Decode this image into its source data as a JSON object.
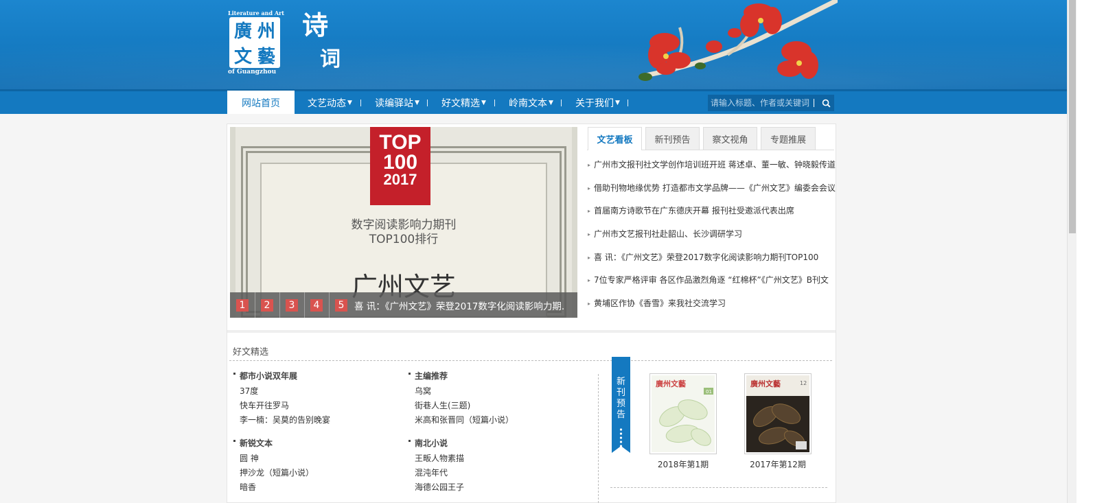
{
  "header": {
    "logo": {
      "top_text": "Literature and Art",
      "bottom_text": "of Guangzhou",
      "mark_chars": [
        "廣",
        "州",
        "文",
        "藝"
      ]
    },
    "section_title": [
      "诗",
      "词"
    ]
  },
  "nav": {
    "home": "网站首页",
    "items": [
      "文艺动态",
      "读编驿站",
      "好文精选",
      "岭南文本",
      "关于我们"
    ],
    "search_placeholder": "请输入标题、作者或关键词"
  },
  "slider": {
    "badge": [
      "TOP",
      "100",
      "2017"
    ],
    "line1": "数字阅读影响力期刊",
    "line2": "TOP100排行",
    "title": "广州文艺",
    "dots": [
      "1",
      "2",
      "3",
      "4",
      "5"
    ],
    "caption": "喜 讯：《广州文艺》荣登2017数字化阅读影响力期."
  },
  "tabs": [
    "文艺看板",
    "新刊预告",
    "察文视角",
    "专题推展"
  ],
  "news": [
    "广州市文报刊社文学创作培训班开班 蒋述卓、董一敏、钟晓毅传道",
    "借助刊物地缘优势 打造都市文学品牌——《广州文艺》编委会会议",
    "首届南方诗歌节在广东德庆开幕 报刊社受邀派代表出席",
    "广州市文艺报刊社赴韶山、长沙调研学习",
    "喜 讯：《广州文艺》荣登2017数字化阅读影响力期刊TOP100",
    "7位专家严格评审 各区作品激烈角逐 “红棉杯”《广州文艺》B刊文",
    "黄埔区作协《香雪》来我社交流学习"
  ],
  "good": {
    "title": "好文精选",
    "columns": [
      [
        {
          "heading": "都市小说双年展",
          "items": [
            "37度",
            "快车开往罗马",
            "李一楠：吴莫的告别晚宴"
          ]
        },
        {
          "heading": "新锐文本",
          "items": [
            "圆 神",
            "押沙龙（短篇小说）",
            "暗香"
          ]
        }
      ],
      [
        {
          "heading": "主编推荐",
          "items": [
            "乌窝",
            "街巷人生(三题)",
            "米高和张晋同（短篇小说）"
          ]
        },
        {
          "heading": "南北小说",
          "items": [
            "王畈人物素描",
            "混沌年代",
            "海德公园王子"
          ]
        }
      ]
    ]
  },
  "new_issue": {
    "ribbon_label": "新刊预告",
    "covers": [
      {
        "caption": "2018年第1期",
        "issue_no": "01",
        "brand": "廣州文藝"
      },
      {
        "caption": "2017年第12期",
        "issue_no": "12",
        "brand": "廣州文藝"
      }
    ]
  },
  "colors": {
    "brand_blue": "#1479c0",
    "accent_red": "#c4202a"
  }
}
